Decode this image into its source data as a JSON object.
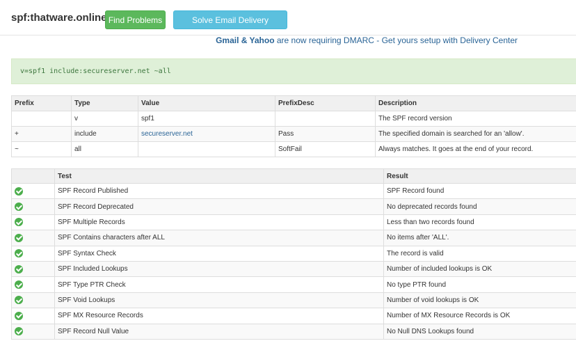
{
  "header": {
    "title": "spf:thatware.online",
    "find_problems_label": "Find Problems",
    "solve_email_label": "Solve Email Delivery Problems"
  },
  "notice": {
    "highlight": "Gmail & Yahoo",
    "text": " are now requiring DMARC - Get yours setup with Delivery Center"
  },
  "record": "v=spf1 include:secureserver.net ~all",
  "spf_table": {
    "headers": [
      "Prefix",
      "Type",
      "Value",
      "PrefixDesc",
      "Description"
    ],
    "rows": [
      {
        "prefix": "",
        "type": "v",
        "value": "spf1",
        "prefix_desc": "",
        "description": "The SPF record version"
      },
      {
        "prefix": "+",
        "type": "include",
        "value": "secureserver.net",
        "prefix_desc": "Pass",
        "description": "The specified domain is searched for an 'allow'."
      },
      {
        "prefix": "~",
        "type": "all",
        "value": "",
        "prefix_desc": "SoftFail",
        "description": "Always matches. It goes at the end of your record."
      }
    ]
  },
  "test_table": {
    "headers": [
      "",
      "Test",
      "Result"
    ],
    "rows": [
      {
        "status": "check-circle-icon",
        "test": "SPF Record Published",
        "result": "SPF Record found"
      },
      {
        "status": "check-circle-icon",
        "test": "SPF Record Deprecated",
        "result": "No deprecated records found"
      },
      {
        "status": "check-circle-icon",
        "test": "SPF Multiple Records",
        "result": "Less than two records found"
      },
      {
        "status": "check-circle-icon",
        "test": "SPF Contains characters after ALL",
        "result": "No items after 'ALL'."
      },
      {
        "status": "check-circle-icon",
        "test": "SPF Syntax Check",
        "result": "The record is valid"
      },
      {
        "status": "check-circle-icon",
        "test": "SPF Included Lookups",
        "result": "Number of included lookups is OK"
      },
      {
        "status": "check-circle-icon",
        "test": "SPF Type PTR Check",
        "result": "No type PTR found"
      },
      {
        "status": "check-circle-icon",
        "test": "SPF Void Lookups",
        "result": "Number of void lookups is OK"
      },
      {
        "status": "check-circle-icon",
        "test": "SPF MX Resource Records",
        "result": "Number of MX Resource Records is OK"
      },
      {
        "status": "check-circle-icon",
        "test": "SPF Record Null Value",
        "result": "No Null DNS Lookups found"
      }
    ]
  },
  "colors": {
    "success_green": "#5cb85c",
    "info_blue": "#5bc0de",
    "link_blue": "#2a6496",
    "record_bg": "#dff0d8",
    "record_text": "#3c763d"
  }
}
